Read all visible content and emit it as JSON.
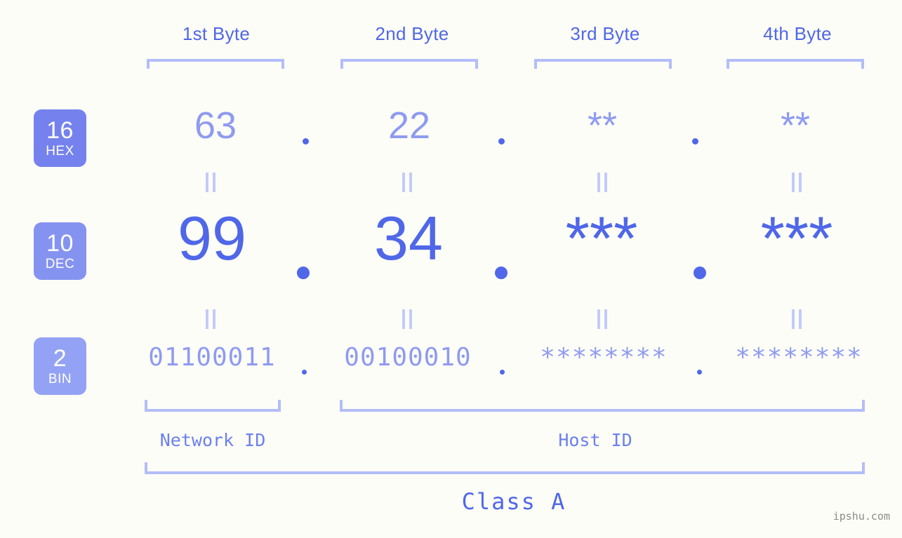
{
  "meta": {
    "background": "#fdfdf8",
    "accent_strong": "#4f67e8",
    "accent_light": "#8e9bf0",
    "bracket_color": "#b3bdf7",
    "watermark": "ipshu.com"
  },
  "headers": [
    {
      "label": "1st Byte"
    },
    {
      "label": "2nd Byte"
    },
    {
      "label": "3rd Byte"
    },
    {
      "label": "4th Byte"
    }
  ],
  "bases": [
    {
      "num": "16",
      "name": "HEX",
      "color": "#7582ed"
    },
    {
      "num": "10",
      "name": "DEC",
      "color": "#8593f0"
    },
    {
      "num": "2",
      "name": "BIN",
      "color": "#93a2f4"
    }
  ],
  "rows": {
    "hex": {
      "values": [
        "63",
        "22",
        "**",
        "**"
      ]
    },
    "dec": {
      "values": [
        "99",
        "34",
        "***",
        "***"
      ]
    },
    "bin": {
      "values": [
        "01100011",
        "00100010",
        "********",
        "********"
      ]
    }
  },
  "separators": {
    "dot": ".",
    "equals": "="
  },
  "segments": {
    "network": {
      "label": "Network ID"
    },
    "host": {
      "label": "Host ID"
    },
    "class": {
      "label": "Class A"
    }
  }
}
